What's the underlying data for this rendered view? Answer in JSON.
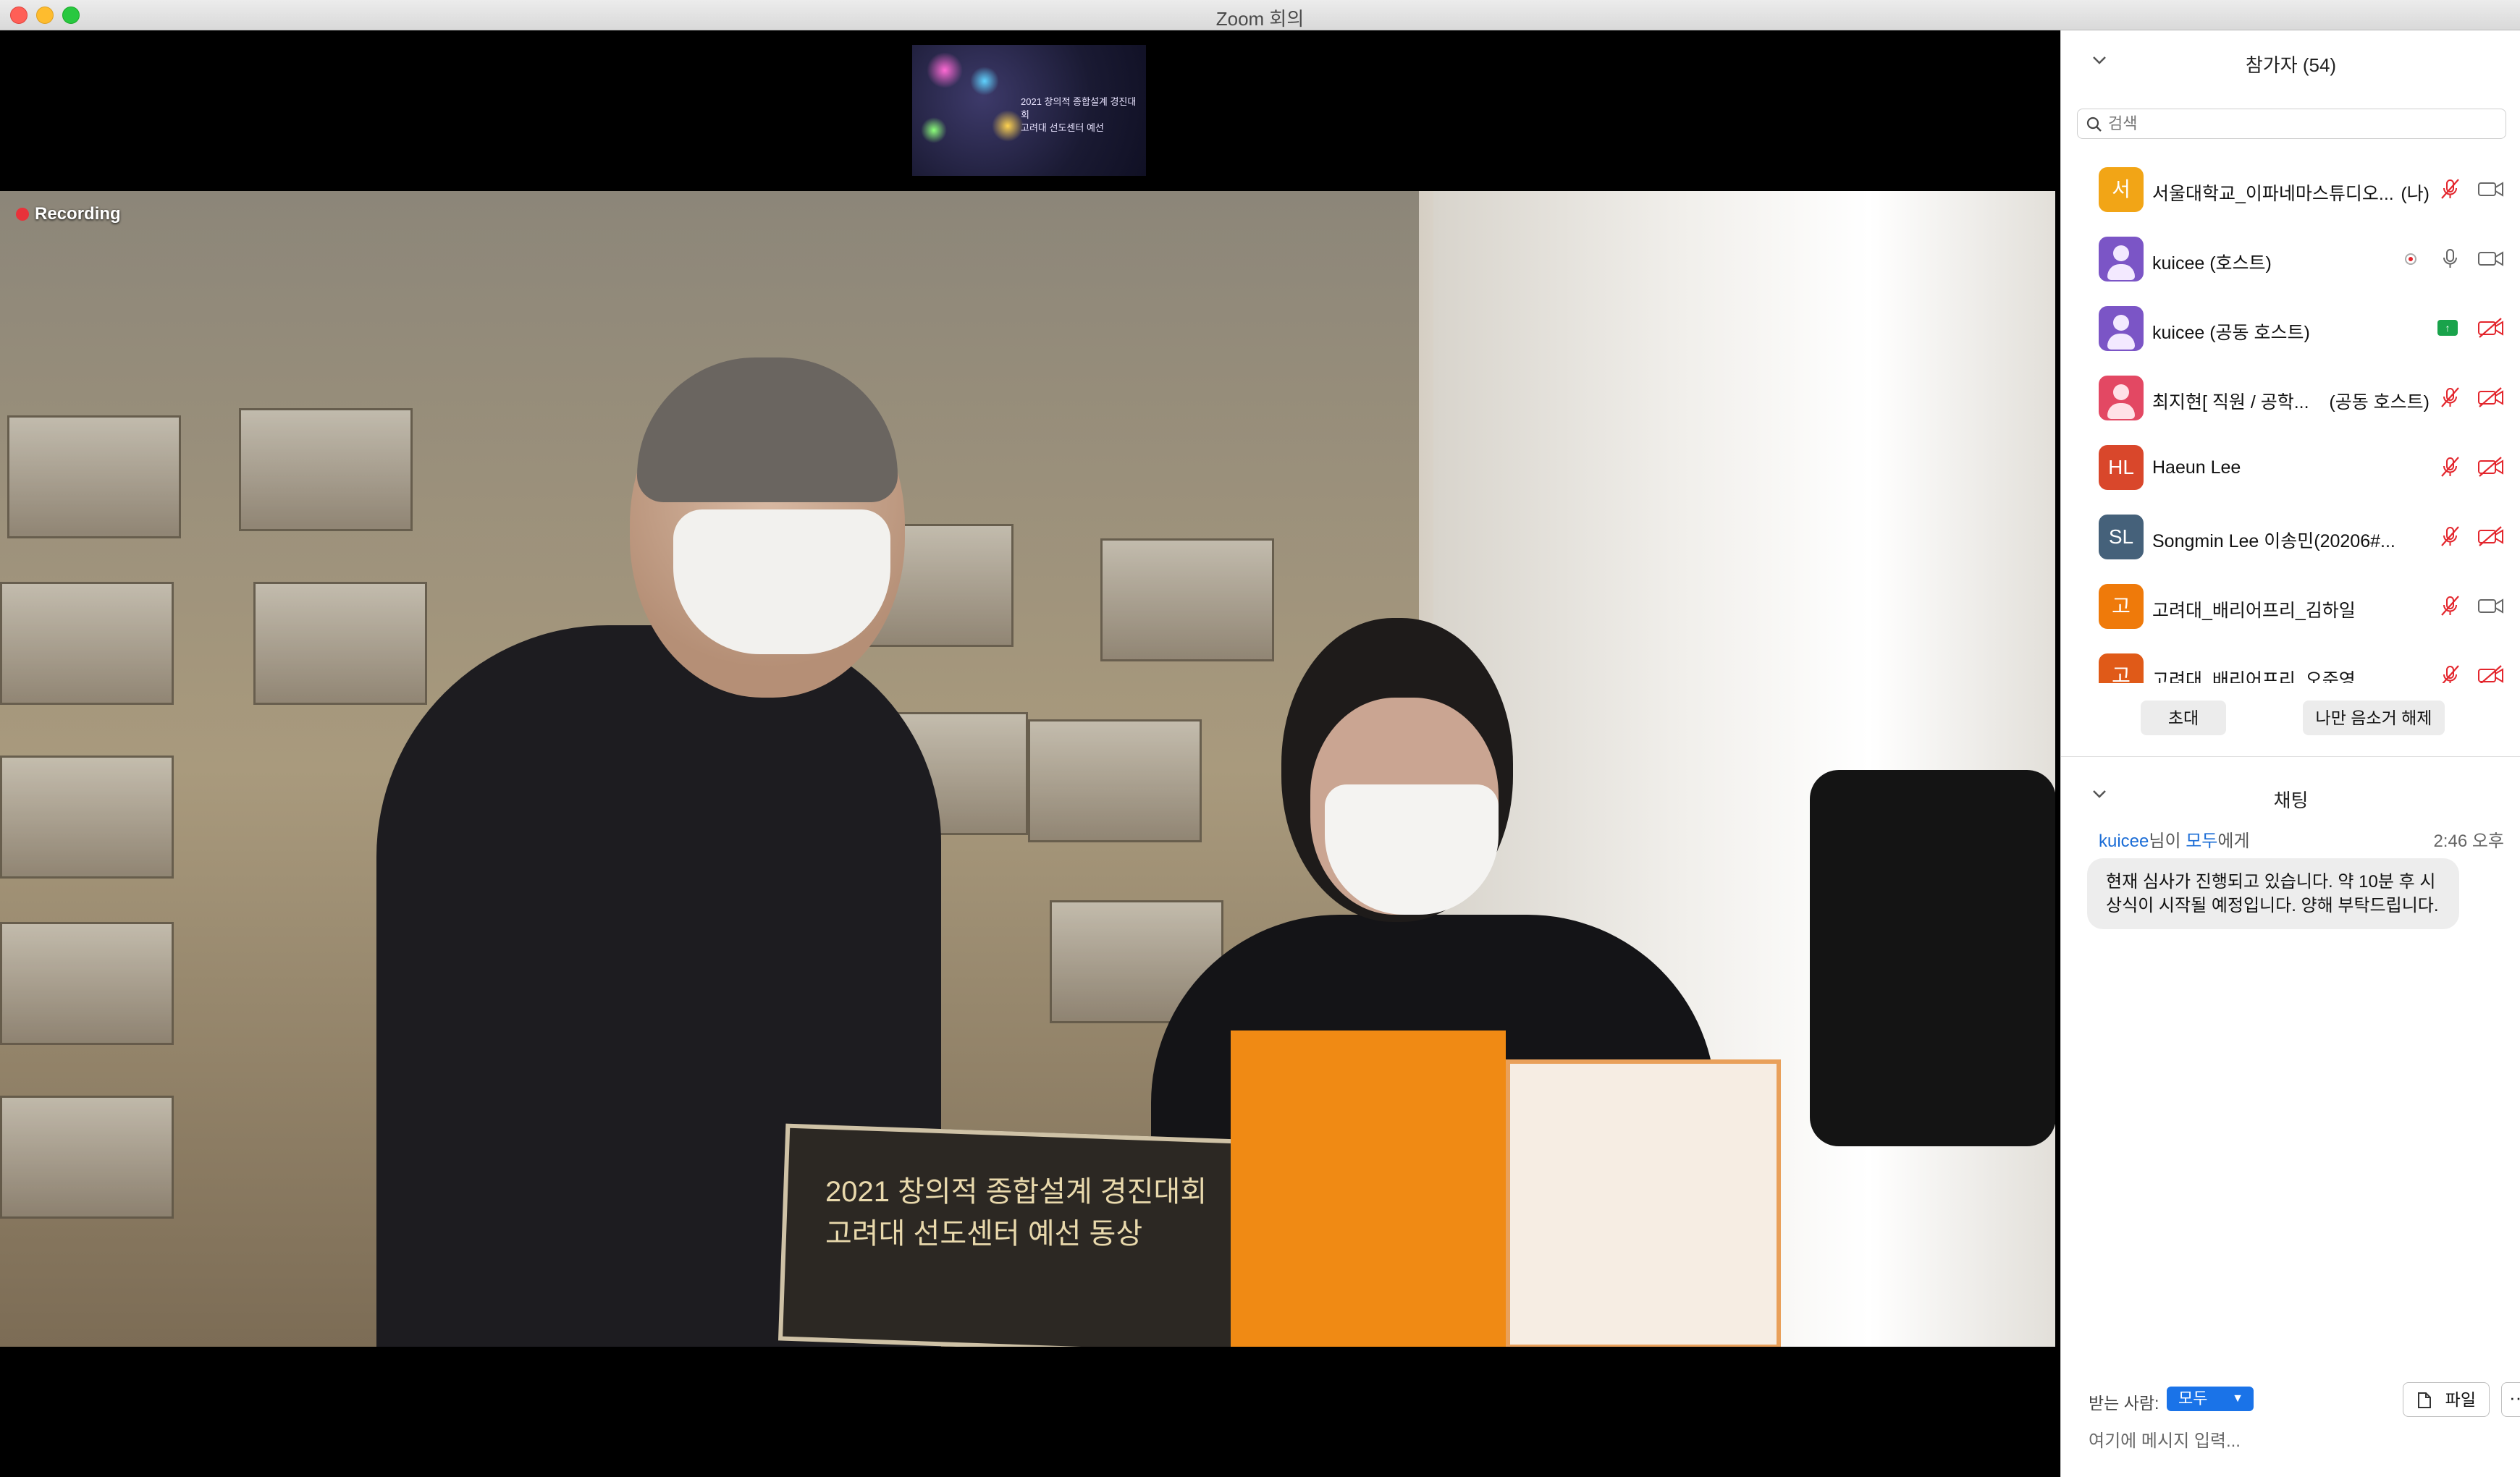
{
  "window": {
    "title": "Zoom 회의"
  },
  "video": {
    "recording_label": "Recording",
    "thumbnail_text": "2021 창의적 종합설계 경진대회\n고려대 선도센터 예선",
    "board_text": "2021 창의적 종합설계 경진대회 고려대 선도센터 예선 동상"
  },
  "participants": {
    "title": "참가자 (54)",
    "search_placeholder": "검색",
    "list": [
      {
        "avatar_text": "서",
        "avatar_color": "#f2a516",
        "name": "서울대학교_이파네마스튜디오...",
        "tag": "(나)",
        "mic": "muted",
        "cam": "on"
      },
      {
        "avatar_text": "",
        "avatar_color": "#7b55c6",
        "name": "kuicee (호스트)",
        "tag": "",
        "mic": "on",
        "cam": "on",
        "recording": true
      },
      {
        "avatar_text": "",
        "avatar_color": "#7b55c6",
        "name": "kuicee (공동 호스트)",
        "tag": "",
        "mic": "share",
        "cam": "off"
      },
      {
        "avatar_text": "",
        "avatar_color": "#e34863",
        "name": "최지현[ 직원 / 공학...",
        "tag": "(공동 호스트)",
        "mic": "muted",
        "cam": "off"
      },
      {
        "avatar_text": "HL",
        "avatar_color": "#d9472b",
        "name": "Haeun Lee",
        "tag": "",
        "mic": "muted",
        "cam": "off"
      },
      {
        "avatar_text": "SL",
        "avatar_color": "#45617a",
        "name": "Songmin Lee 이송민(20206#...",
        "tag": "",
        "mic": "muted",
        "cam": "off"
      },
      {
        "avatar_text": "고",
        "avatar_color": "#ef7a0a",
        "name": "고려대_배리어프리_김하일",
        "tag": "",
        "mic": "muted",
        "cam": "on"
      },
      {
        "avatar_text": "고",
        "avatar_color": "#e05a18",
        "name": "고려대_배리어프리_오준영",
        "tag": "",
        "mic": "muted",
        "cam": "off"
      }
    ],
    "invite_label": "초대",
    "unmute_me_label": "나만 음소거 해제"
  },
  "chat": {
    "title": "채팅",
    "sender": "kuicee",
    "sender_suffix": "님이 ",
    "recipient": "모두",
    "recipient_suffix": "에게",
    "time": "2:46 오후",
    "message": "현재 심사가 진행되고 있습니다. 약 10분 후 시상식이 시작될 예정입니다. 양해 부탁드립니다.",
    "to_label": "받는 사람:",
    "to_value": "모두",
    "file_label": "파일",
    "more_label": "···",
    "input_placeholder": "여기에 메시지 입력..."
  },
  "colors": {
    "accent": "#1a73e8",
    "muted_icon": "#e3262d",
    "recording": "#e8323a"
  }
}
